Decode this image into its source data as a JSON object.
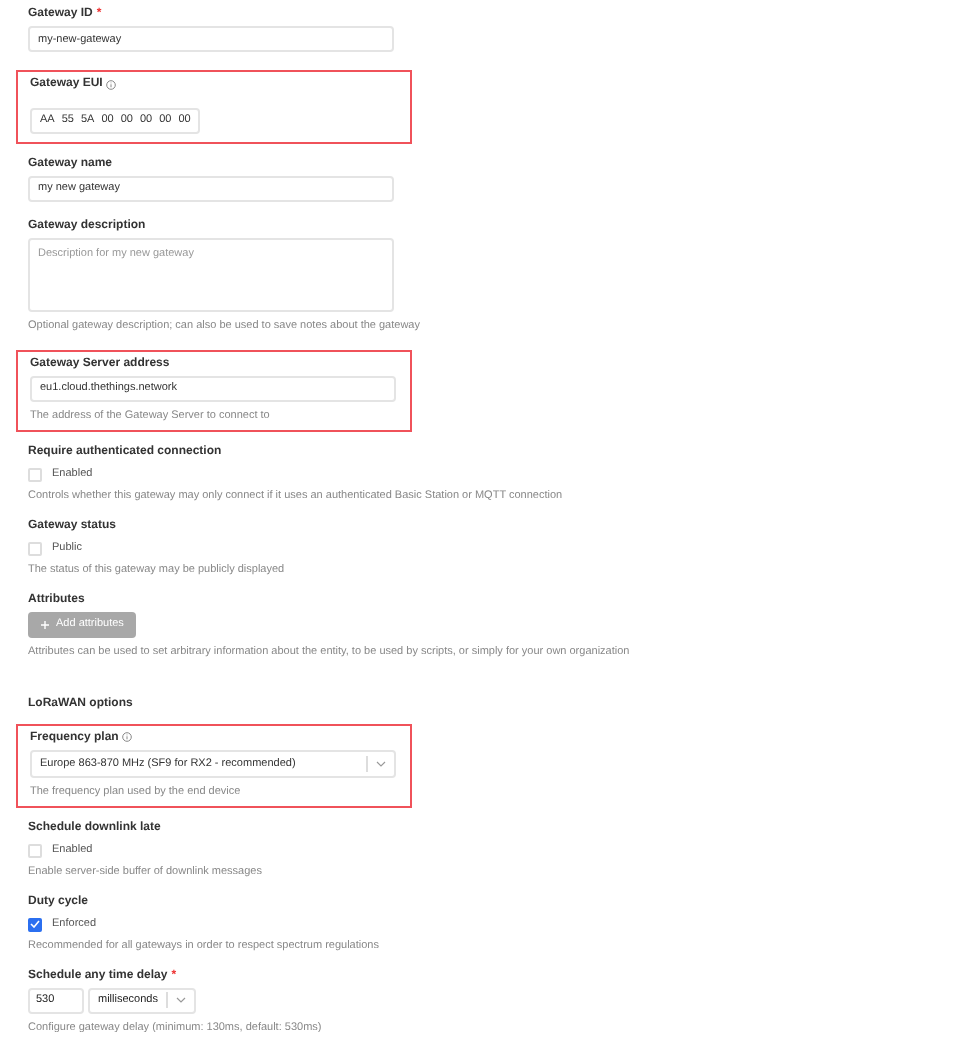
{
  "fields": [
    {
      "kind": "text",
      "label": "Gateway ID",
      "required_mark": "*",
      "value": "my-new-gateway",
      "highlighted": false
    },
    {
      "kind": "eui",
      "label": "Gateway EUI",
      "info": true,
      "bytes": [
        "AA",
        "55",
        "5A",
        "00",
        "00",
        "00",
        "00",
        "00"
      ],
      "highlighted": true
    },
    {
      "kind": "text",
      "label": "Gateway name",
      "value": "my new gateway",
      "highlighted": false
    },
    {
      "kind": "textarea",
      "label": "Gateway description",
      "placeholder": "Description for my new gateway",
      "hint": "Optional gateway description; can also be used to save notes about the gateway",
      "highlighted": false
    },
    {
      "kind": "text",
      "label": "Gateway Server address",
      "value": "eu1.cloud.thethings.network",
      "hint": "The address of the Gateway Server to connect to",
      "highlighted": true
    },
    {
      "kind": "checkbox",
      "label": "Require authenticated connection",
      "option": "Enabled",
      "checked": false,
      "hint": "Controls whether this gateway may only connect if it uses an authenticated Basic Station or MQTT connection",
      "highlighted": false
    },
    {
      "kind": "checkbox",
      "label": "Gateway status",
      "option": "Public",
      "checked": false,
      "hint": "The status of this gateway may be publicly displayed",
      "highlighted": false
    },
    {
      "kind": "button",
      "label": "Attributes",
      "button": "Add attributes",
      "hint": "Attributes can be used to set arbitrary information about the entity, to be used by scripts, or simply for your own organization",
      "highlighted": false
    },
    {
      "kind": "heading",
      "label": "LoRaWAN options"
    },
    {
      "kind": "select",
      "label": "Frequency plan",
      "info": true,
      "value": "Europe 863-870 MHz (SF9 for RX2 - recommended)",
      "hint": "The frequency plan used by the end device",
      "highlighted": true
    },
    {
      "kind": "checkbox",
      "label": "Schedule downlink late",
      "option": "Enabled",
      "checked": false,
      "hint": "Enable server-side buffer of downlink messages",
      "highlighted": false
    },
    {
      "kind": "checkbox",
      "label": "Duty cycle",
      "option": "Enforced",
      "checked": true,
      "hint": "Recommended for all gateways in order to respect spectrum regulations",
      "highlighted": false
    },
    {
      "kind": "number-unit",
      "label": "Schedule any time delay",
      "required_mark": "*",
      "value": "530",
      "unit": "milliseconds",
      "hint": "Configure gateway delay (minimum: 130ms, default: 530ms)",
      "highlighted": false
    }
  ]
}
